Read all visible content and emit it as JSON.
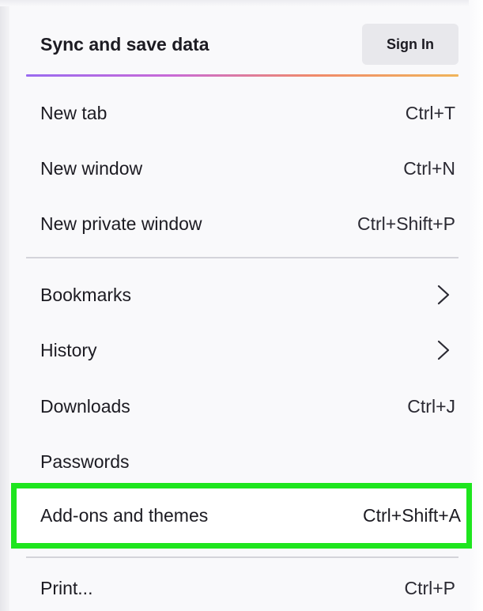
{
  "header": {
    "title": "Sync and save data",
    "sign_in_label": "Sign In"
  },
  "menu": {
    "group1": [
      {
        "label": "New tab",
        "shortcut": "Ctrl+T"
      },
      {
        "label": "New window",
        "shortcut": "Ctrl+N"
      },
      {
        "label": "New private window",
        "shortcut": "Ctrl+Shift+P"
      }
    ],
    "group2": [
      {
        "label": "Bookmarks",
        "icon": "chevron-right-icon"
      },
      {
        "label": "History",
        "icon": "chevron-right-icon"
      },
      {
        "label": "Downloads",
        "shortcut": "Ctrl+J"
      },
      {
        "label": "Passwords"
      },
      {
        "label": "Add-ons and themes",
        "shortcut": "Ctrl+Shift+A",
        "highlighted": true
      }
    ],
    "group3": [
      {
        "label": "Print...",
        "shortcut": "Ctrl+P"
      }
    ]
  },
  "colors": {
    "highlight_border": "#1ee51e",
    "accent_gradient": [
      "#9a6bf0",
      "#c86ad7",
      "#f08a6a",
      "#f0b45a"
    ],
    "panel_background": "#f9f9fb"
  }
}
